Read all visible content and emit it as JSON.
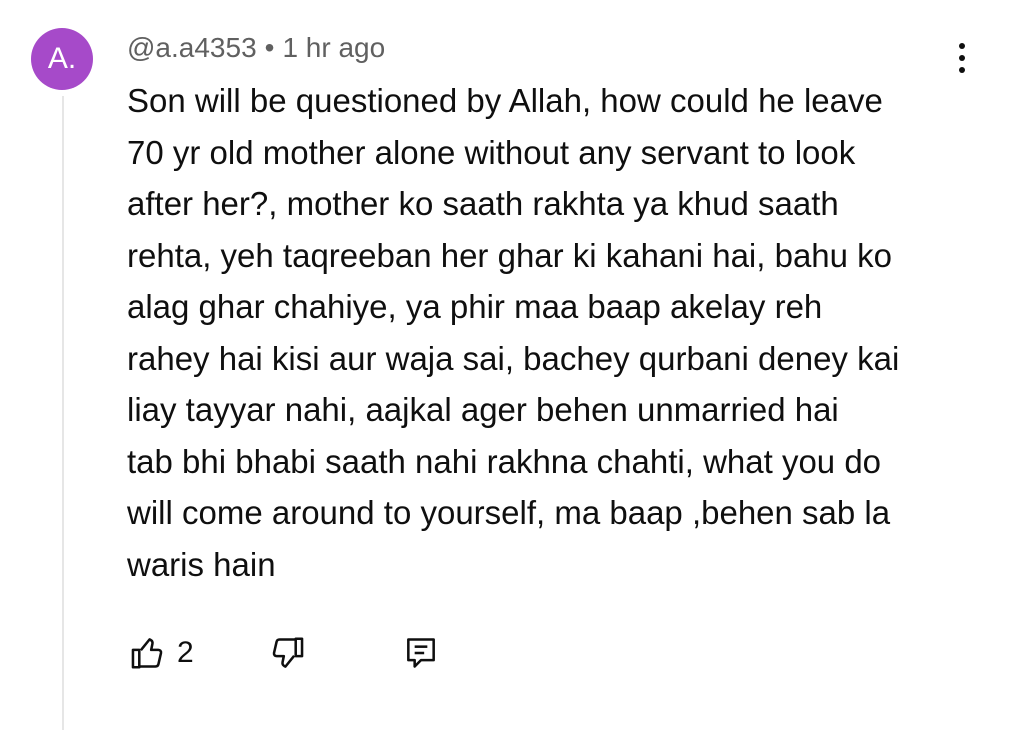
{
  "comment": {
    "avatar_initial": "A.",
    "author": "@a.a4353",
    "separator": "•",
    "timestamp": "1 hr ago",
    "text": "Son will be questioned by Allah, how could he leave\n70 yr old mother alone without any servant to look\nafter her?, mother ko saath rakhta ya khud saath\nrehta, yeh taqreeban her ghar ki kahani hai, bahu ko\nalag ghar chahiye, ya phir maa baap akelay reh\nrahey hai kisi aur waja sai, bachey qurbani deney kai\nliay tayyar  nahi, aajkal ager behen unmarried hai\ntab bhi bhabi saath nahi rakhna chahti, what you do\nwill come around to yourself, ma baap ,behen sab la\nwaris hain",
    "like_count": "2",
    "avatar_color": "#a64ac9"
  },
  "icons": {
    "like": "thumbs-up-icon",
    "dislike": "thumbs-down-icon",
    "reply": "reply-comment-icon",
    "more": "more-vertical-icon"
  }
}
